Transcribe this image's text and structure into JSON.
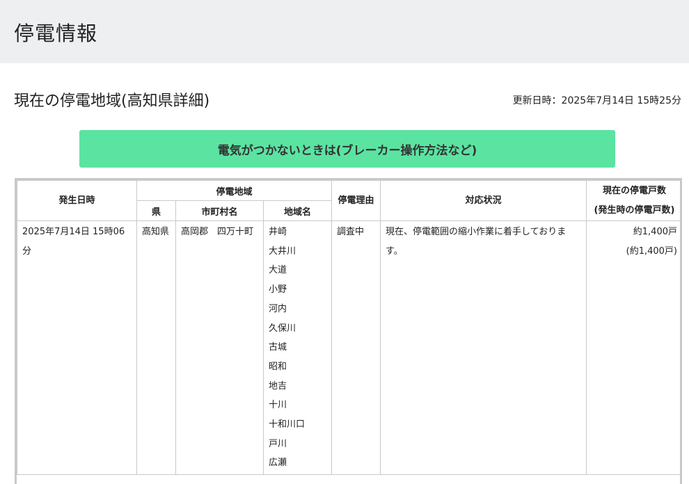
{
  "header": {
    "title": "停電情報"
  },
  "section": {
    "title": "現在の停電地域(高知県詳細)",
    "updated": "更新日時：2025年7月14日 15時25分"
  },
  "cta": {
    "label": "電気がつかないときは(ブレーカー操作方法など)"
  },
  "table": {
    "headers": {
      "occurred": "発生日時",
      "area_group": "停電地域",
      "pref": "県",
      "city": "市町村名",
      "district": "地域名",
      "reason": "停電理由",
      "status": "対応状況",
      "current_line1": "現在の停電戸数",
      "current_line2": "(発生時の停電戸数)"
    },
    "rows": [
      {
        "occurred": "2025年7月14日 15時06分",
        "pref": "高知県",
        "city": "高岡郡　四万十町",
        "districts": [
          "井崎",
          "大井川",
          "大道",
          "小野",
          "河内",
          "久保川",
          "古城",
          "昭和",
          "地吉",
          "十川",
          "十和川口",
          "戸川",
          "広瀬"
        ],
        "reason": "調査中",
        "status": "現在、停電範囲の縮小作業に着手しております。",
        "current": "約1,400戸",
        "initial": "(約1,400戸)"
      }
    ]
  }
}
